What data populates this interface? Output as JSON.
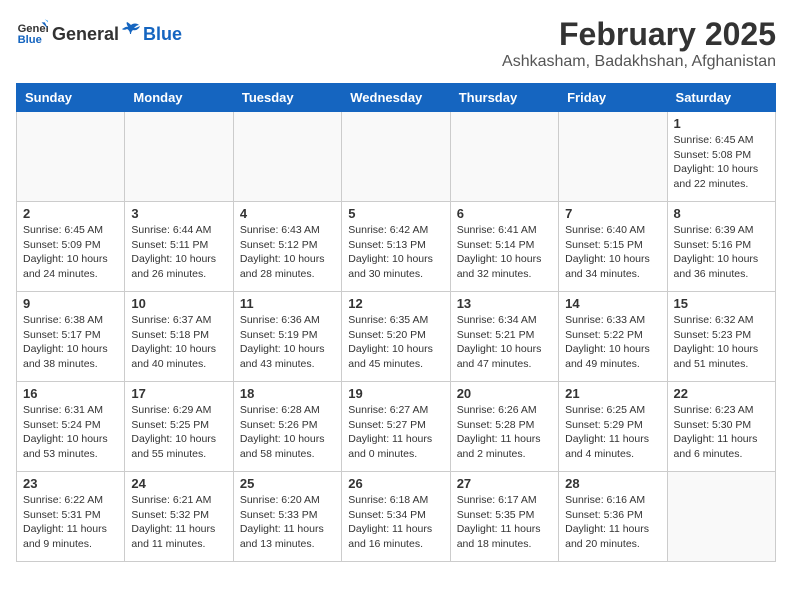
{
  "header": {
    "logo_general": "General",
    "logo_blue": "Blue",
    "month_year": "February 2025",
    "location": "Ashkasham, Badakhshan, Afghanistan"
  },
  "days_of_week": [
    "Sunday",
    "Monday",
    "Tuesday",
    "Wednesday",
    "Thursday",
    "Friday",
    "Saturday"
  ],
  "weeks": [
    [
      {
        "day": "",
        "info": ""
      },
      {
        "day": "",
        "info": ""
      },
      {
        "day": "",
        "info": ""
      },
      {
        "day": "",
        "info": ""
      },
      {
        "day": "",
        "info": ""
      },
      {
        "day": "",
        "info": ""
      },
      {
        "day": "1",
        "info": "Sunrise: 6:45 AM\nSunset: 5:08 PM\nDaylight: 10 hours and 22 minutes."
      }
    ],
    [
      {
        "day": "2",
        "info": "Sunrise: 6:45 AM\nSunset: 5:09 PM\nDaylight: 10 hours and 24 minutes."
      },
      {
        "day": "3",
        "info": "Sunrise: 6:44 AM\nSunset: 5:11 PM\nDaylight: 10 hours and 26 minutes."
      },
      {
        "day": "4",
        "info": "Sunrise: 6:43 AM\nSunset: 5:12 PM\nDaylight: 10 hours and 28 minutes."
      },
      {
        "day": "5",
        "info": "Sunrise: 6:42 AM\nSunset: 5:13 PM\nDaylight: 10 hours and 30 minutes."
      },
      {
        "day": "6",
        "info": "Sunrise: 6:41 AM\nSunset: 5:14 PM\nDaylight: 10 hours and 32 minutes."
      },
      {
        "day": "7",
        "info": "Sunrise: 6:40 AM\nSunset: 5:15 PM\nDaylight: 10 hours and 34 minutes."
      },
      {
        "day": "8",
        "info": "Sunrise: 6:39 AM\nSunset: 5:16 PM\nDaylight: 10 hours and 36 minutes."
      }
    ],
    [
      {
        "day": "9",
        "info": "Sunrise: 6:38 AM\nSunset: 5:17 PM\nDaylight: 10 hours and 38 minutes."
      },
      {
        "day": "10",
        "info": "Sunrise: 6:37 AM\nSunset: 5:18 PM\nDaylight: 10 hours and 40 minutes."
      },
      {
        "day": "11",
        "info": "Sunrise: 6:36 AM\nSunset: 5:19 PM\nDaylight: 10 hours and 43 minutes."
      },
      {
        "day": "12",
        "info": "Sunrise: 6:35 AM\nSunset: 5:20 PM\nDaylight: 10 hours and 45 minutes."
      },
      {
        "day": "13",
        "info": "Sunrise: 6:34 AM\nSunset: 5:21 PM\nDaylight: 10 hours and 47 minutes."
      },
      {
        "day": "14",
        "info": "Sunrise: 6:33 AM\nSunset: 5:22 PM\nDaylight: 10 hours and 49 minutes."
      },
      {
        "day": "15",
        "info": "Sunrise: 6:32 AM\nSunset: 5:23 PM\nDaylight: 10 hours and 51 minutes."
      }
    ],
    [
      {
        "day": "16",
        "info": "Sunrise: 6:31 AM\nSunset: 5:24 PM\nDaylight: 10 hours and 53 minutes."
      },
      {
        "day": "17",
        "info": "Sunrise: 6:29 AM\nSunset: 5:25 PM\nDaylight: 10 hours and 55 minutes."
      },
      {
        "day": "18",
        "info": "Sunrise: 6:28 AM\nSunset: 5:26 PM\nDaylight: 10 hours and 58 minutes."
      },
      {
        "day": "19",
        "info": "Sunrise: 6:27 AM\nSunset: 5:27 PM\nDaylight: 11 hours and 0 minutes."
      },
      {
        "day": "20",
        "info": "Sunrise: 6:26 AM\nSunset: 5:28 PM\nDaylight: 11 hours and 2 minutes."
      },
      {
        "day": "21",
        "info": "Sunrise: 6:25 AM\nSunset: 5:29 PM\nDaylight: 11 hours and 4 minutes."
      },
      {
        "day": "22",
        "info": "Sunrise: 6:23 AM\nSunset: 5:30 PM\nDaylight: 11 hours and 6 minutes."
      }
    ],
    [
      {
        "day": "23",
        "info": "Sunrise: 6:22 AM\nSunset: 5:31 PM\nDaylight: 11 hours and 9 minutes."
      },
      {
        "day": "24",
        "info": "Sunrise: 6:21 AM\nSunset: 5:32 PM\nDaylight: 11 hours and 11 minutes."
      },
      {
        "day": "25",
        "info": "Sunrise: 6:20 AM\nSunset: 5:33 PM\nDaylight: 11 hours and 13 minutes."
      },
      {
        "day": "26",
        "info": "Sunrise: 6:18 AM\nSunset: 5:34 PM\nDaylight: 11 hours and 16 minutes."
      },
      {
        "day": "27",
        "info": "Sunrise: 6:17 AM\nSunset: 5:35 PM\nDaylight: 11 hours and 18 minutes."
      },
      {
        "day": "28",
        "info": "Sunrise: 6:16 AM\nSunset: 5:36 PM\nDaylight: 11 hours and 20 minutes."
      },
      {
        "day": "",
        "info": ""
      }
    ]
  ]
}
